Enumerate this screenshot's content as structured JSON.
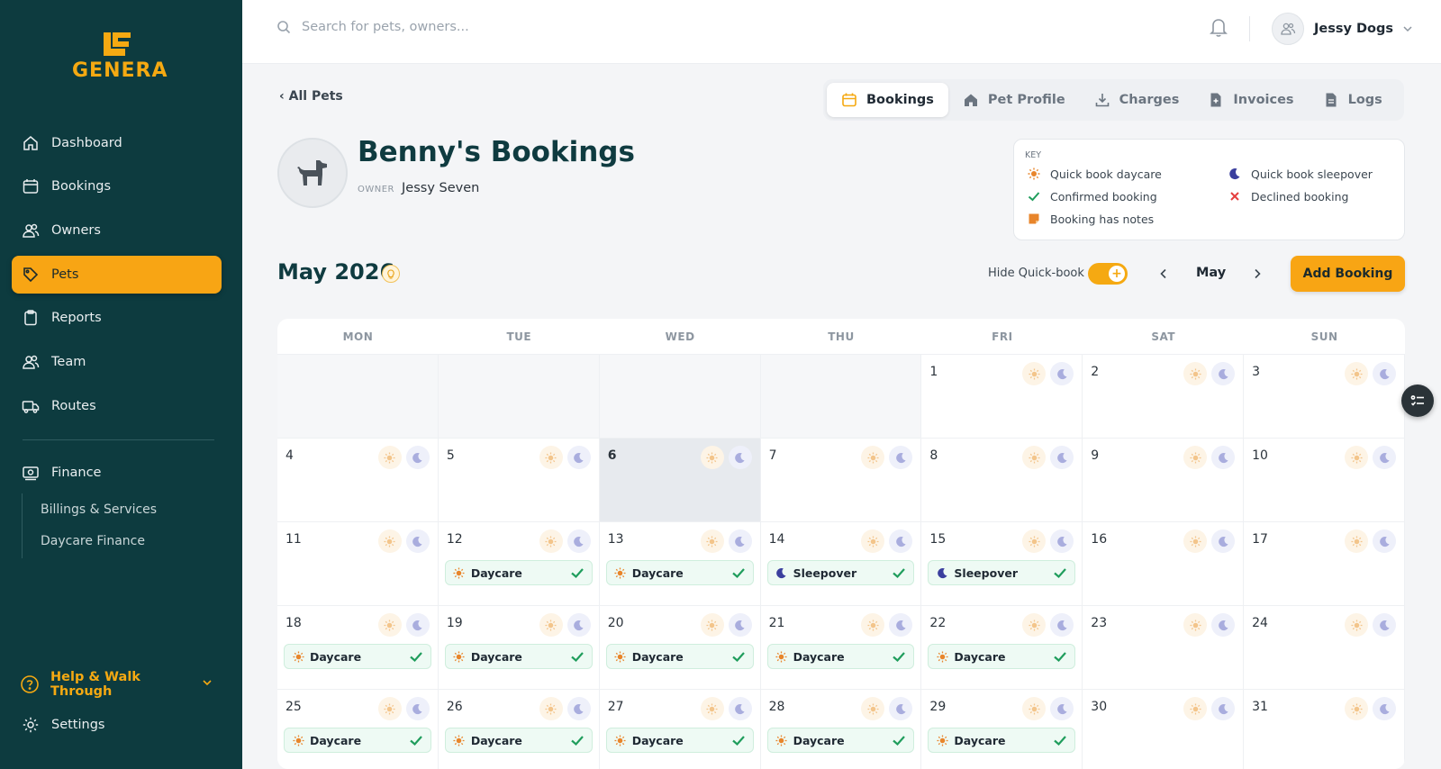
{
  "brand": {
    "name": "GENERA",
    "color": "#f5a912"
  },
  "sidebar": {
    "items": [
      {
        "label": "Dashboard",
        "icon": "home-icon"
      },
      {
        "label": "Bookings",
        "icon": "calendar-icon"
      },
      {
        "label": "Owners",
        "icon": "users-icon"
      },
      {
        "label": "Pets",
        "icon": "tag-icon",
        "active": true
      },
      {
        "label": "Reports",
        "icon": "clipboard-icon"
      },
      {
        "label": "Team",
        "icon": "team-icon"
      },
      {
        "label": "Routes",
        "icon": "truck-icon"
      },
      {
        "label": "Finance",
        "icon": "money-icon"
      }
    ],
    "finance_sub": [
      "Billings & Services",
      "Daycare Finance"
    ],
    "help": "Help & Walk Through",
    "settings": "Settings"
  },
  "topbar": {
    "search_placeholder": "Search for pets, owners...",
    "user_name": "Jessy Dogs"
  },
  "back_link": "All Pets",
  "tabs": [
    {
      "label": "Bookings",
      "icon": "calendar-icon",
      "active": true
    },
    {
      "label": "Pet Profile",
      "icon": "home-icon"
    },
    {
      "label": "Charges",
      "icon": "download-icon"
    },
    {
      "label": "Invoices",
      "icon": "invoice-icon"
    },
    {
      "label": "Logs",
      "icon": "document-icon"
    }
  ],
  "pet": {
    "title": "Benny's Bookings",
    "owner_label": "OWNER",
    "owner_name": "Jessy Seven"
  },
  "key": {
    "title": "KEY",
    "items": [
      "Quick book daycare",
      "Quick book sleepover",
      "Confirmed booking",
      "Declined booking",
      "Booking has notes"
    ]
  },
  "calendar_controls": {
    "month_title": "May 2026",
    "hide_quickbook_label": "Hide Quick-book",
    "hide_quickbook_on": true,
    "month_label": "May",
    "add_button": "Add Booking"
  },
  "calendar": {
    "weekdays": [
      "MON",
      "TUE",
      "WED",
      "THU",
      "FRI",
      "SAT",
      "SUN"
    ],
    "leading_blank_days": 4,
    "days_in_month": 31,
    "today": 6,
    "bookings": [
      {
        "day": 12,
        "type": "Daycare",
        "status": "confirmed"
      },
      {
        "day": 13,
        "type": "Daycare",
        "status": "confirmed"
      },
      {
        "day": 14,
        "type": "Sleepover",
        "status": "confirmed"
      },
      {
        "day": 15,
        "type": "Sleepover",
        "status": "confirmed"
      },
      {
        "day": 18,
        "type": "Daycare",
        "status": "confirmed"
      },
      {
        "day": 19,
        "type": "Daycare",
        "status": "confirmed"
      },
      {
        "day": 20,
        "type": "Daycare",
        "status": "confirmed"
      },
      {
        "day": 21,
        "type": "Daycare",
        "status": "confirmed"
      },
      {
        "day": 22,
        "type": "Daycare",
        "status": "confirmed"
      },
      {
        "day": 25,
        "type": "Daycare",
        "status": "confirmed"
      },
      {
        "day": 26,
        "type": "Daycare",
        "status": "confirmed"
      },
      {
        "day": 27,
        "type": "Daycare",
        "status": "confirmed"
      },
      {
        "day": 28,
        "type": "Daycare",
        "status": "confirmed"
      },
      {
        "day": 29,
        "type": "Daycare",
        "status": "confirmed"
      }
    ]
  },
  "colors": {
    "sidebar_bg": "#0d3b3f",
    "accent": "#f8a514",
    "confirmed": "#1f9d5c",
    "declined": "#e53e3e",
    "sleepover": "#3b3f9e"
  }
}
